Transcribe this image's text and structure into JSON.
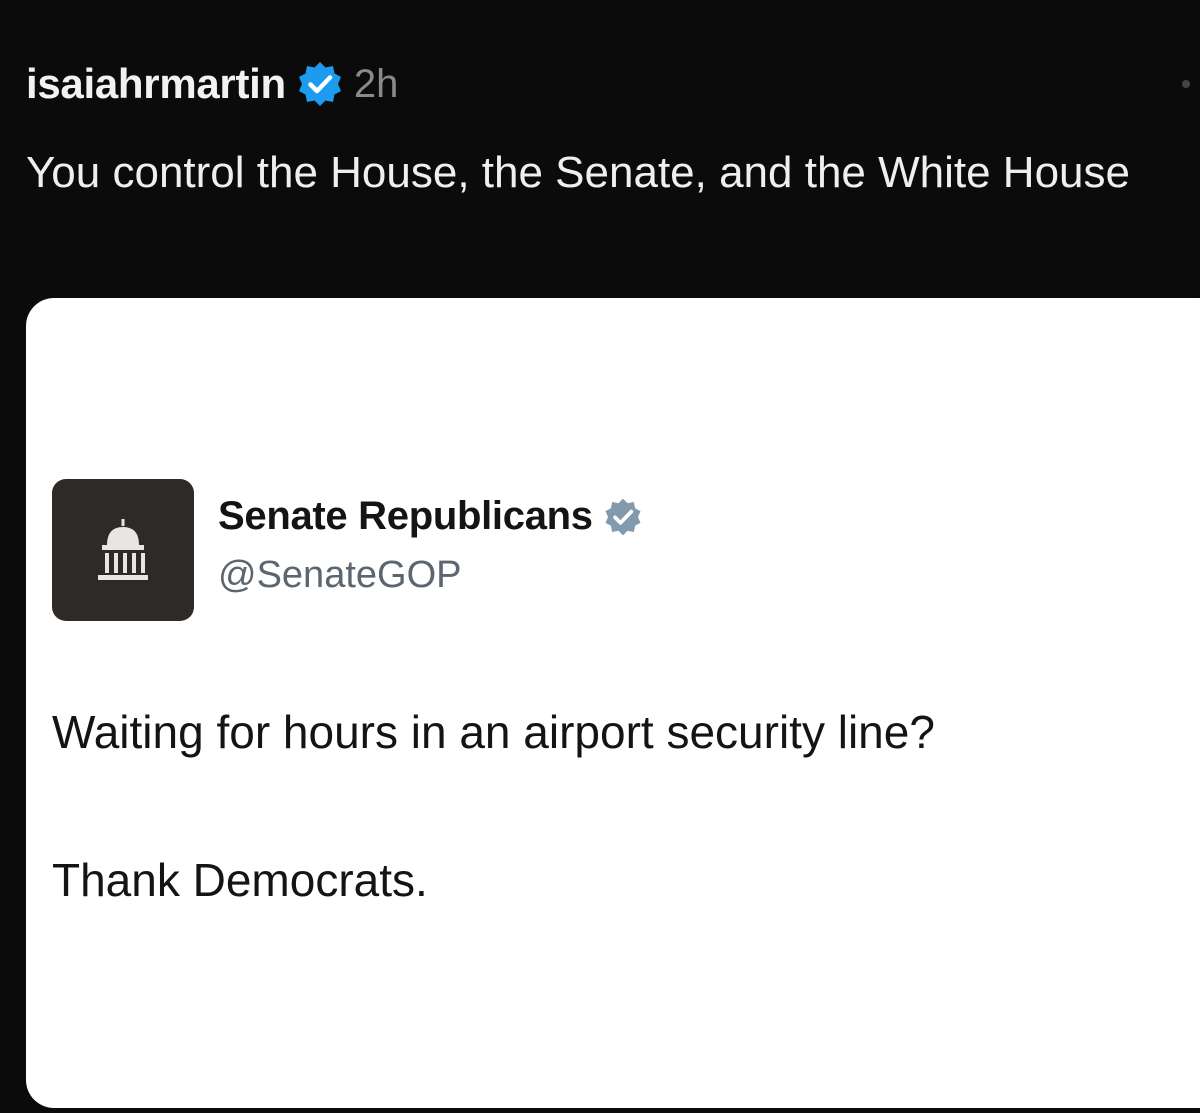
{
  "post": {
    "username": "isaiahrmartin",
    "time": "2h",
    "text": "You control the House, the Senate, and the White House",
    "verified_badge_color": "#1d9bf0",
    "icons": [
      "verified-badge-icon",
      "more-options-icon"
    ]
  },
  "quoted_post": {
    "author_name": "Senate Republicans",
    "handle": "@SenateGOP",
    "avatar_icon": "capitol-building-icon",
    "badge_icon": "gray-verified-badge-icon",
    "badge_color": "#829aab",
    "line1": "Waiting for hours in an airport security line?",
    "line2": "Thank Democrats."
  }
}
